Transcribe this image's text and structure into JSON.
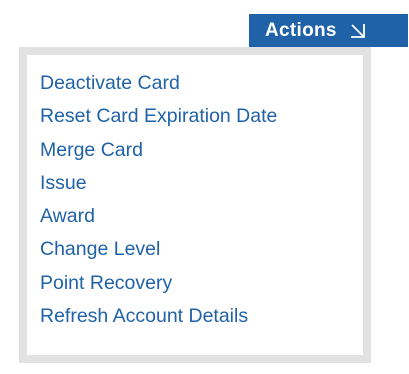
{
  "actions_button": {
    "label": "Actions",
    "icon": "arrow-down-right-icon",
    "color": "#1f62a8"
  },
  "menu": {
    "border_color": "#e2e2e2",
    "link_color": "#1f62a8",
    "items": [
      {
        "label": "Deactivate Card"
      },
      {
        "label": "Reset Card Expiration Date"
      },
      {
        "label": "Merge Card"
      },
      {
        "label": "Issue"
      },
      {
        "label": "Award"
      },
      {
        "label": "Change Level"
      },
      {
        "label": "Point Recovery"
      },
      {
        "label": "Refresh Account Details"
      }
    ]
  }
}
